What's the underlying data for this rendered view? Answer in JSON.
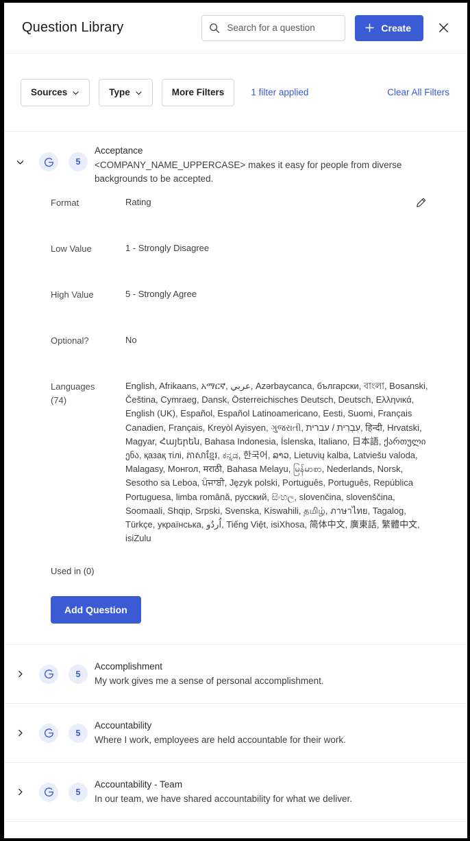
{
  "header": {
    "title": "Question Library",
    "search": {
      "placeholder": "Search for a question",
      "value": "",
      "icon": "search-icon"
    },
    "create_label": "Create",
    "create_icon": "plus-icon",
    "close_icon": "close-icon",
    "accent_color": "#3b5bd4"
  },
  "filters": {
    "sources_label": "Sources",
    "type_label": "Type",
    "more_filters_label": "More Filters",
    "applied_label": "1 filter applied",
    "clear_all_label": "Clear All Filters",
    "chevron_icon": "chevron-down-icon",
    "link_color": "#3b5bd4"
  },
  "questions": [
    {
      "expanded": true,
      "chevron_icon": "chevron-down-icon",
      "source_icon": "glint-g-icon",
      "scale": "5",
      "name": "Acceptance",
      "body": "<COMPANY_NAME_UPPERCASE> makes it easy for people from diverse backgrounds to be accepted.",
      "details": {
        "format_label": "Format",
        "format_value": "Rating",
        "low_value_label": "Low Value",
        "low_value_value": "1 - Strongly Disagree",
        "high_value_label": "High Value",
        "high_value_value": "5 - Strongly Agree",
        "optional_label": "Optional?",
        "optional_value": "No",
        "languages_label": "Languages",
        "languages_count": "(74)",
        "languages_value": "English, Afrikaans, አማርኛ, عربي, Azərbaycanca, български, বাংলা, Bosanski, Čeština, Cymraeg, Dansk, Österreichisches Deutsch, Deutsch, Ελληνικά, English (UK), Español, Español Latinoamericano, Eesti, Suomi, Français Canadien, Français, Kreyòl Ayisyen, ગુજરાતી, עִבְרִית / עברית, हिन्दी, Hrvatski, Magyar, Հայերեն, Bahasa Indonesia, Íslenska, Italiano, 日本語, ქართული ენა, қазақ тілі, ភាសាខ្មែរ, ಕನ್ನಡ, 한국어, ລາວ, Lietuvių kalba, Latviešu valoda, Malagasy, Монгол, मराठी, Bahasa Melayu, မြန်မာစာ, Nederlands, Norsk, Sesotho sa Leboa, ਪੰਜਾਬੀ, Język polski, Português, Português, República Portuguesa, limba română, русский, සිංහල, slovenčina, slovenščina, Soomaali, Shqip, Srpski, Svenska, Kiswahili, தமிழ், ภาษาไทย, Tagalog, Türkçe, українська, اُردُو, Tiếng Việt, isiXhosa, 简体中文, 廣東話, 繁體中文, isiZulu",
        "edit_icon": "edit-pencil-icon",
        "used_in_label": "Used in (0)",
        "add_question_label": "Add Question"
      }
    },
    {
      "expanded": false,
      "chevron_icon": "chevron-right-icon",
      "source_icon": "glint-g-icon",
      "scale": "5",
      "name": "Accomplishment",
      "body": "My work gives me a sense of personal accomplishment."
    },
    {
      "expanded": false,
      "chevron_icon": "chevron-right-icon",
      "source_icon": "glint-g-icon",
      "scale": "5",
      "name": "Accountability",
      "body": "Where I work, employees are held accountable for their work."
    },
    {
      "expanded": false,
      "chevron_icon": "chevron-right-icon",
      "source_icon": "glint-g-icon",
      "scale": "5",
      "name": "Accountability - Team",
      "body": "In our team, we have shared accountability for what we deliver."
    }
  ]
}
